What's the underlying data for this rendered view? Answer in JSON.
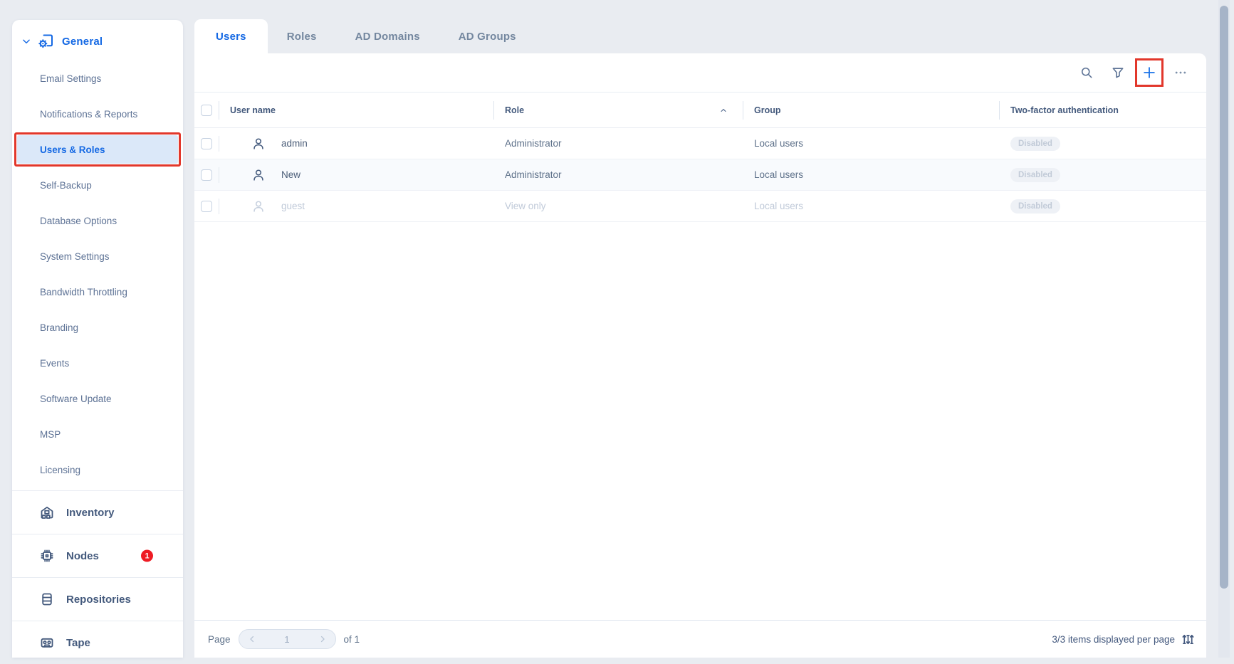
{
  "colors": {
    "accent_blue": "#1569e4",
    "annotation_red": "#e2372b",
    "badge_red": "#ee1c24",
    "page_background": "#e9ecf1",
    "active_item_background": "#dbe8f9",
    "disabled_text": "#bfc9d8"
  },
  "sidebar": {
    "general": {
      "label": "General",
      "icon": "gear-window-icon",
      "chevron": "chevron-down-icon",
      "items": [
        "Email Settings",
        "Notifications & Reports",
        "Users & Roles",
        "Self-Backup",
        "Database Options",
        "System Settings",
        "Bandwidth Throttling",
        "Branding",
        "Events",
        "Software Update",
        "MSP",
        "Licensing"
      ],
      "active_item": "Users & Roles"
    },
    "sections": [
      {
        "label": "Inventory",
        "icon": "warehouse-icon"
      },
      {
        "label": "Nodes",
        "icon": "chip-icon",
        "badge": "1"
      },
      {
        "label": "Repositories",
        "icon": "database-icon"
      },
      {
        "label": "Tape",
        "icon": "tape-icon"
      }
    ]
  },
  "tabs": [
    {
      "label": "Users",
      "active": true
    },
    {
      "label": "Roles",
      "active": false
    },
    {
      "label": "AD Domains",
      "active": false
    },
    {
      "label": "AD Groups",
      "active": false
    }
  ],
  "toolbar": {
    "icons": [
      "search-icon",
      "filter-icon",
      "add-icon",
      "more-icon"
    ],
    "highlighted_icon": "add-icon"
  },
  "table": {
    "columns": [
      "User name",
      "Role",
      "Group",
      "Two-factor authentication"
    ],
    "sorted_column": "Role",
    "sort_direction": "ascending",
    "rows": [
      {
        "name": "admin",
        "role": "Administrator",
        "group": "Local users",
        "two_factor": "Disabled",
        "disabled": false
      },
      {
        "name": "New",
        "role": "Administrator",
        "group": "Local users",
        "two_factor": "Disabled",
        "disabled": false
      },
      {
        "name": "guest",
        "role": "View only",
        "group": "Local users",
        "two_factor": "Disabled",
        "disabled": true
      }
    ]
  },
  "footer": {
    "page_label": "Page",
    "current_page": "1",
    "of_label": "of 1",
    "items_summary": "3/3 items displayed per page",
    "items_icon": "sliders-icon"
  }
}
